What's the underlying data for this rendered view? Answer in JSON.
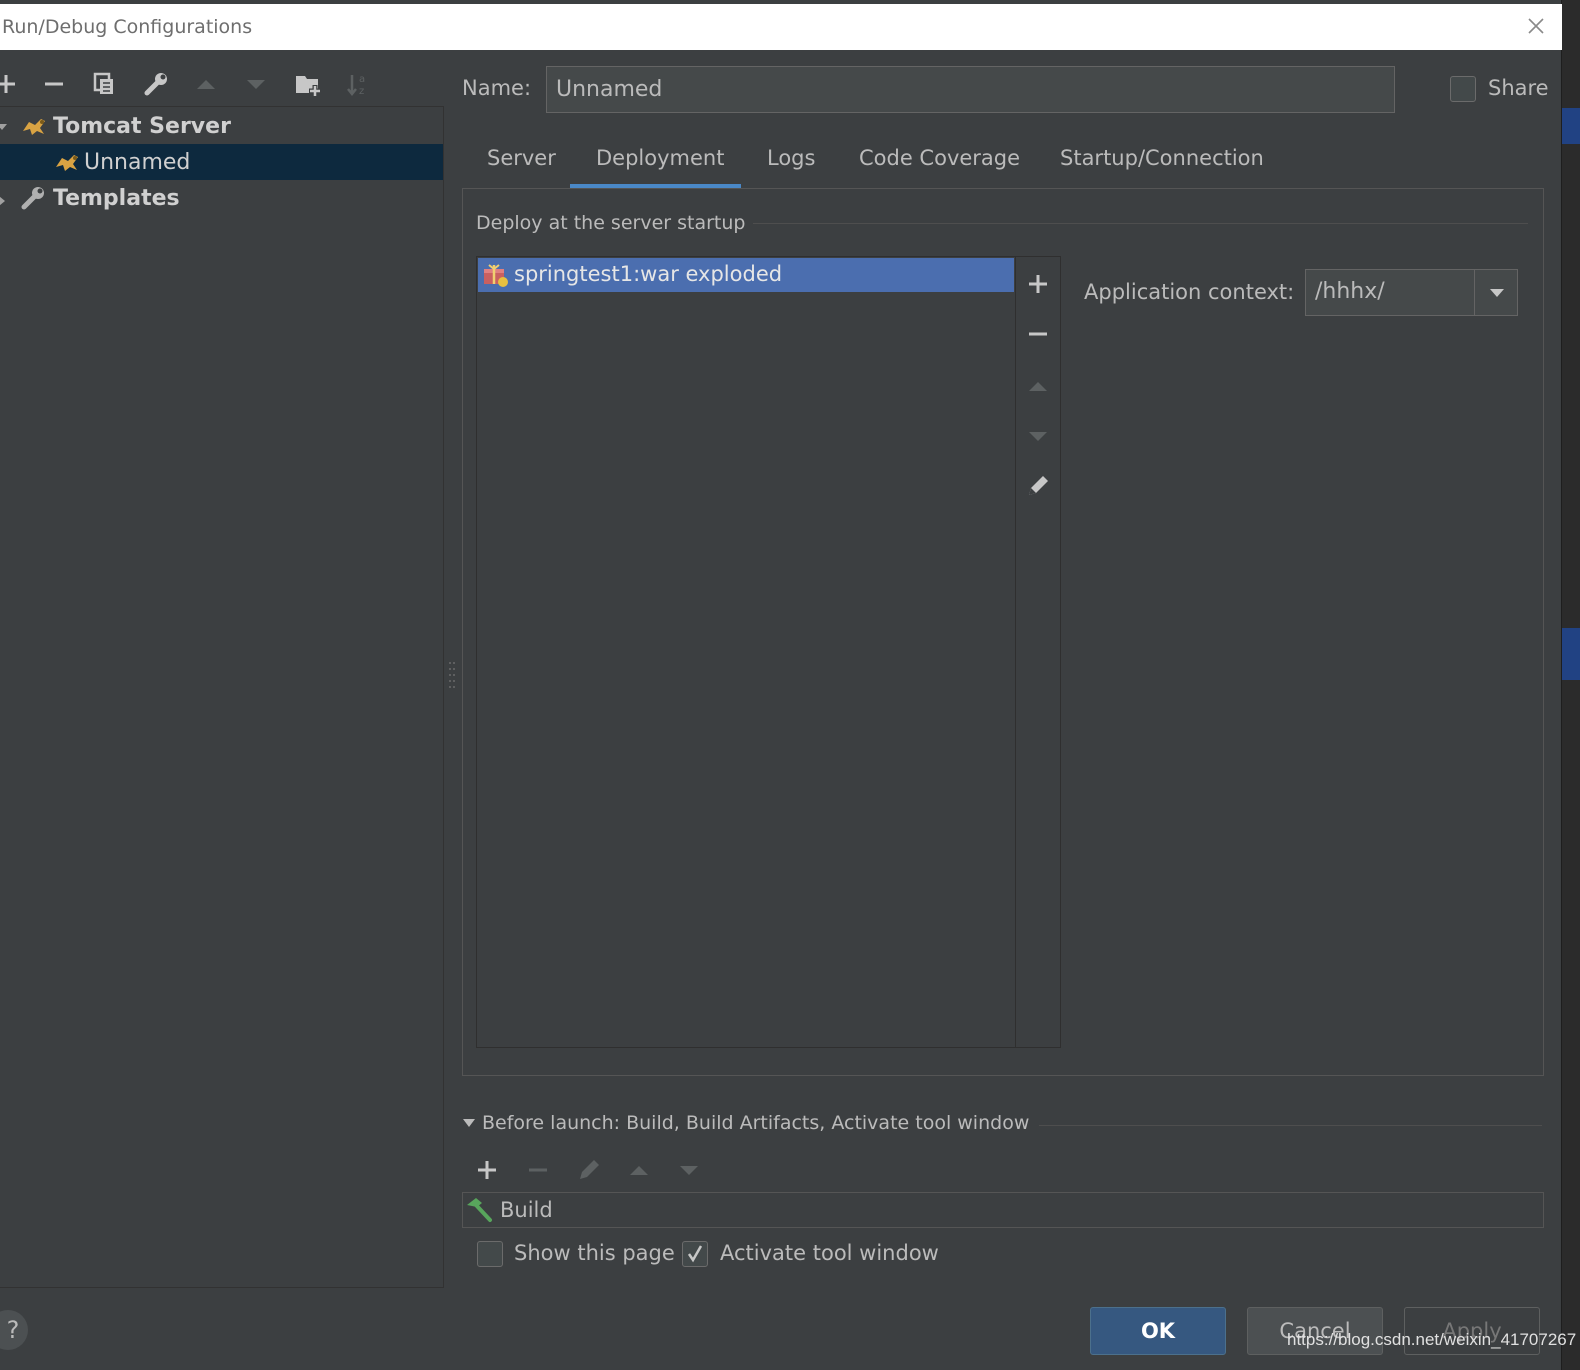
{
  "window": {
    "title": "Run/Debug Configurations"
  },
  "left_toolbar": {
    "icons": [
      "add-icon",
      "remove-icon",
      "copy-icon",
      "wrench-icon",
      "move-up-icon",
      "move-down-icon",
      "new-folder-icon",
      "sort-icon"
    ]
  },
  "tree": {
    "items": [
      {
        "label": "Tomcat Server",
        "icon": "tomcat-icon",
        "expanded": true
      },
      {
        "label": "Unnamed",
        "icon": "tomcat-icon",
        "selected": true
      },
      {
        "label": "Templates",
        "icon": "wrench-icon",
        "expanded": false
      }
    ]
  },
  "name_row": {
    "label": "Name:",
    "value": "Unnamed",
    "share_label": "Share",
    "share_checked": false
  },
  "tabs": [
    {
      "label": "Server"
    },
    {
      "label": "Deployment",
      "active": true
    },
    {
      "label": "Logs"
    },
    {
      "label": "Code Coverage"
    },
    {
      "label": "Startup/Connection"
    }
  ],
  "deployment": {
    "group_title": "Deploy at the server startup",
    "artifacts": [
      {
        "label": "springtest1:war exploded",
        "icon": "artifact-icon",
        "selected": true
      }
    ],
    "side_icons": [
      "add-icon",
      "remove-icon",
      "move-up-icon",
      "move-down-icon",
      "edit-icon"
    ],
    "app_context_label": "Application context:",
    "app_context_value": "/hhhx/"
  },
  "before_launch": {
    "title": "Before launch: Build, Build Artifacts, Activate tool window",
    "tools": [
      "add-icon",
      "remove-icon",
      "edit-icon",
      "move-up-icon",
      "move-down-icon"
    ],
    "items": [
      {
        "label": "Build",
        "icon": "build-hammer-icon"
      }
    ],
    "show_page_label": "Show this page",
    "show_page_checked": false,
    "activate_label": "Activate tool window",
    "activate_checked": true
  },
  "buttons": {
    "help": "?",
    "ok": "OK",
    "cancel": "Cancel",
    "apply": "Apply"
  },
  "watermark": "https://blog.csdn.net/weixin_41707267",
  "colors": {
    "background": "#3c3f41",
    "selection": "#0d293e",
    "list_selection": "#4b6eaf",
    "accent": "#4a88c7",
    "ok_button": "#365880"
  }
}
